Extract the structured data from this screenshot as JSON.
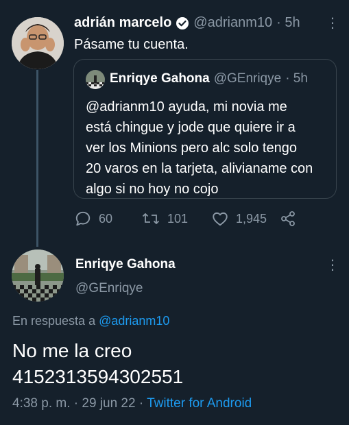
{
  "tweet": {
    "author_name": "adrián marcelo",
    "handle": "@adrianm10",
    "time": "· 5h",
    "text": "Pásame tu cuenta.",
    "quote": {
      "author_name": "Enriqye Gahona",
      "handle": "@GEnriqye",
      "time": "· 5h",
      "lines": [
        "@adrianm10 ayuda, mi novia me",
        "está chingue y jode que quiere ir a",
        "ver los Minions pero alc solo tengo",
        "20 varos en la tarjeta, alivianame con",
        "algo si no hoy no cojo"
      ]
    },
    "actions": {
      "replies": "60",
      "retweets": "101",
      "likes": "1,945"
    }
  },
  "reply": {
    "author_name": "Enriqye Gahona",
    "handle": "@GEnriqye",
    "replying_prefix": "En respuesta a",
    "replying_to": "@adrianm10",
    "text_lines": [
      "No me la creo",
      "4152313594302551"
    ],
    "timestamp": "4:38 p. m. · 29 jun 22 ·",
    "source": "Twitter for Android"
  },
  "colors": {
    "background": "#15202b",
    "accent": "#1d9bf0",
    "muted": "#8b98a5",
    "border": "#38444d"
  }
}
